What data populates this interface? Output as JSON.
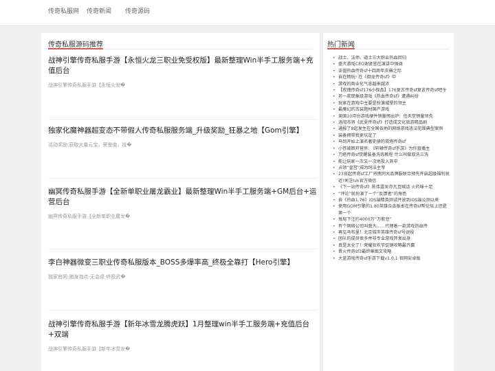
{
  "nav": {
    "items": [
      "传奇私服网",
      "传奇新闻",
      "传奇源码"
    ]
  },
  "main": {
    "heading": "传奇私服源码推荐",
    "articles": [
      {
        "title": "战神引擎传奇私服手游【永恒火龙三职业免受权版】最新整理Win半手工服务端+充值后台",
        "excerpt": "战神引擎传奇私服手游【永恒火龙�"
      },
      {
        "title": "独家化魔神器超变态不带假人传奇私服服务端_升级奖励_狂暴之地【Gom引擎】",
        "excerpt": "活动奖励:获取大量元宝，荣誉值，技�"
      },
      {
        "title": "幽冥传奇私服手游【全新单职业屠龙霸业】最新整理Win半手工服务端+GM后台+运营后台",
        "excerpt": "幽冥传奇私服手游【全新单职业屠龙�"
      },
      {
        "title": "李白神器微变三职业传奇私服版本_BOSS多爆率高_终极全靠打【Hero引擎】",
        "excerpt": "独家官网:随身泡点-无会成-终极武�"
      },
      {
        "title": "战神引擎传奇私服手游【新年冰雪龙腾虎跃】1月整理win半手工服务端+充值后台+双端",
        "excerpt": "战神引擎传奇私服手游【新年冰雪龙�"
      }
    ]
  },
  "side": {
    "heading": "热门新闻",
    "news": [
      "战士、法师、道士三大职业热血回归",
      "盛大游戏CEO谢贤誉在演讲中强调",
      "正值热血传奇sf十四周年庆典之际",
      "自在畅玩! 在《御龙传奇sf》中",
      "游戏的商业化气息越来越浓",
      "【玫瑰传奇sf176小极品】176复古传奇sf复古传奇sf吧令",
      "另一款现象级游戏《热血传奇sf》遭遇纠纷",
      "玩家在游戏中主要是扮演城堡的领主",
      "最魔幻的古装题材国产游戏",
      "美国10月份游戏硬件销量榜出炉：任天堂销量领先",
      "洛阳市将《武夏传奇sf》打造成文化旅游精品剧",
      "通报了8起发生在全国各地的网络游戏违法犯罪典型案例",
      "装备拥带我更坑定了",
      "马到开始上演名著史册的双塔传奇sf",
      "小苍被困开营房: 《轩辕传奇sf手游》为你直播主",
      "刀塔传奇sf觉醒装备洗练教程 什么叫做双洗三洗",
      "能让玩家一次又一次地投入其中",
      "占领“皇宫”成为玛法主宰",
      "23日起传奇sf工厂将携同大品牌服联合预先开启超级福利就近!关注tvk官方微信",
      "《下一站传奇sf》陈伟霆吴亦凡互喊话 火药味十足",
      "“评论”就扮演了一个“反馈者”的角色",
      "自《热血1.76》iOS端精英测试开放到iOS端公测以来",
      "使用GOM引擎的1.80英雄合击版本在传奇sf帮论坛上还是第一个",
      "每局下注约4000万“万能豆”",
      "有个网络公司叫盛大……代理着一款游戏热血传",
      "再见马布里！北京城市英雄传奇sf号退役",
      "团队的成员很多并非专业游戏开发出身",
      "真是太全了！荣耀狂欢节促销攻略最齐赢",
      "晋火传奇sf3最终章图文攻略",
      "大蓝游戏传奇sf手游下载v1.0.1 官网安卓版"
    ]
  }
}
